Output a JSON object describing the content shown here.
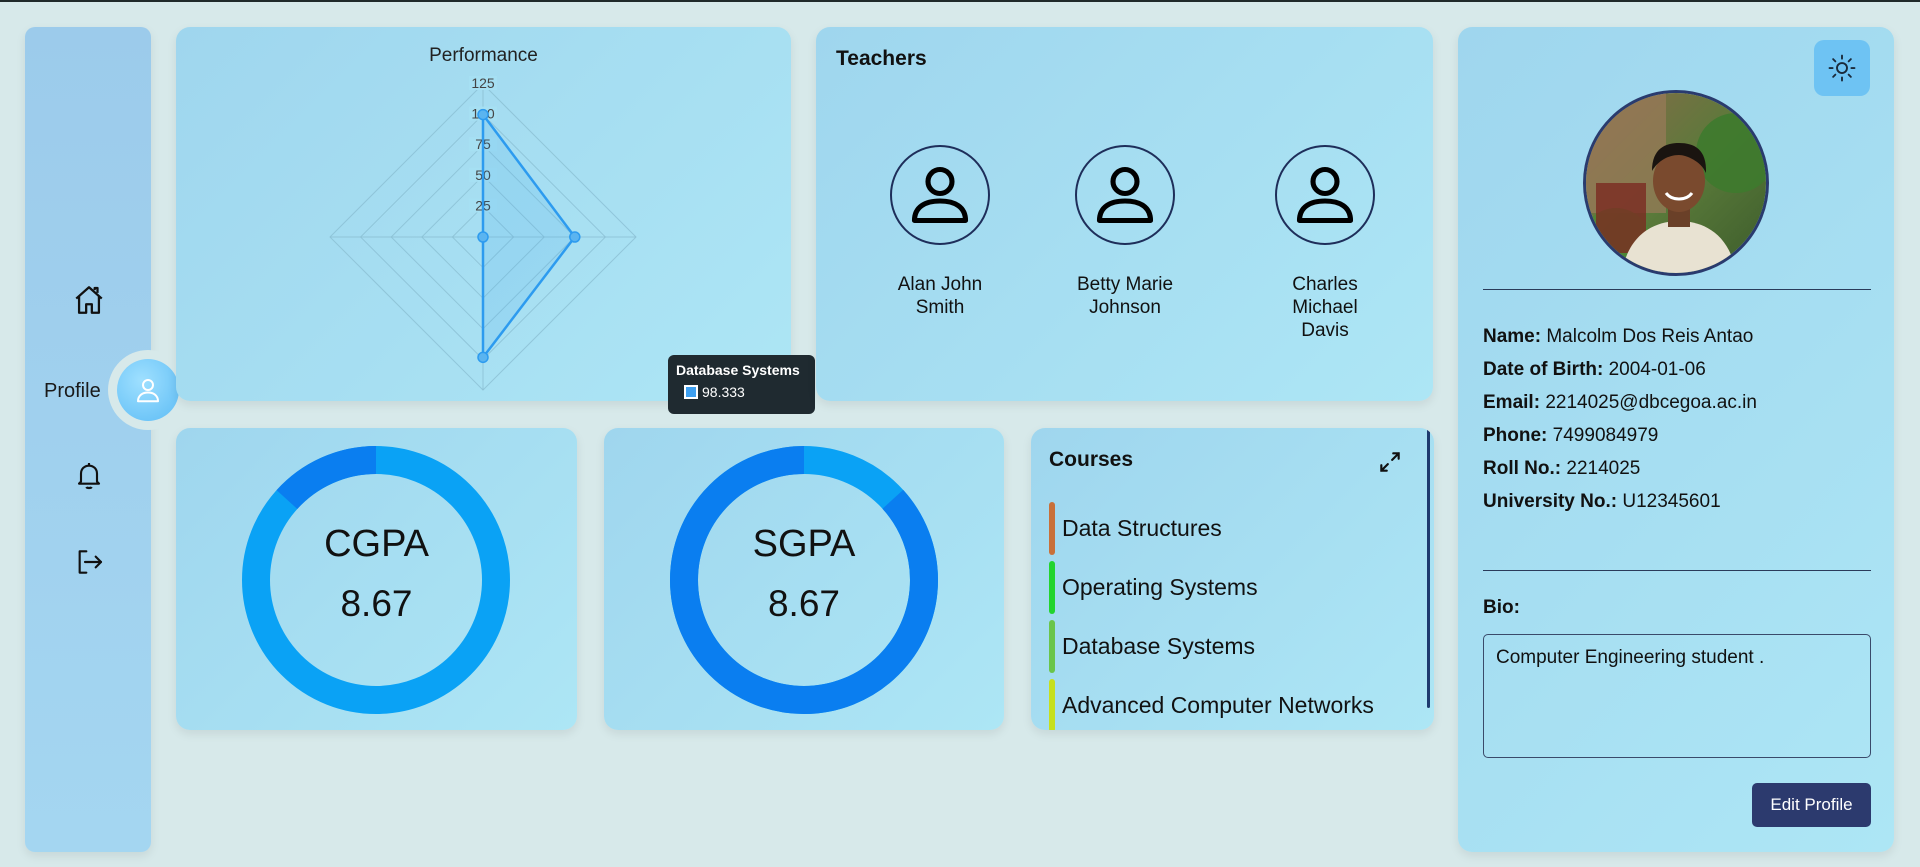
{
  "sidebar": {
    "profile_label": "Profile",
    "items": [
      {
        "icon": "home-icon"
      },
      {
        "icon": "user-icon"
      },
      {
        "icon": "bell-icon"
      },
      {
        "icon": "logout-icon"
      }
    ]
  },
  "performance": {
    "title": "Performance",
    "tooltip": {
      "label": "Database Systems",
      "value": "98.333"
    }
  },
  "chart_data": {
    "type": "radar",
    "title": "Performance",
    "categories": [
      "",
      "",
      "Database Systems",
      ""
    ],
    "values": [
      100,
      75,
      98.333,
      0
    ],
    "rlim": [
      0,
      125
    ],
    "ticks": [
      "25",
      "50",
      "75",
      "100",
      "125"
    ],
    "color": "#2d9bef"
  },
  "teachers": {
    "title": "Teachers",
    "list": [
      {
        "name": "Alan John Smith"
      },
      {
        "name": "Betty Marie Johnson"
      },
      {
        "name": "Charles Michael Davis"
      }
    ]
  },
  "profile": {
    "name_label": "Name:",
    "name": "Malcolm Dos Reis Antao",
    "dob_label": "Date of Birth:",
    "dob": "2004-01-06",
    "email_label": "Email:",
    "email": "2214025@dbcegoa.ac.in",
    "phone_label": "Phone:",
    "phone": "7499084979",
    "roll_label": "Roll No.:",
    "roll": "2214025",
    "univ_label": "University No.:",
    "univ": "U12345601",
    "bio_label": "Bio:",
    "bio": "Computer Engineering student .",
    "edit_label": "Edit Profile"
  },
  "gpa": {
    "cgpa_label": "CGPA",
    "cgpa_value": "8.67",
    "cgpa_fraction": 0.867,
    "sgpa_label": "SGPA",
    "sgpa_value": "8.67",
    "sgpa_fraction": 0.867,
    "colors": {
      "primary": "#0aa2f5",
      "secondary": "#0a7ef0"
    }
  },
  "courses": {
    "title": "Courses",
    "list": [
      {
        "name": "Data Structures",
        "color": "#c8703a"
      },
      {
        "name": "Operating Systems",
        "color": "#22d42e"
      },
      {
        "name": "Database Systems",
        "color": "#6ac54a"
      },
      {
        "name": "Advanced Computer Networks",
        "color": "#c6e01e"
      }
    ]
  }
}
